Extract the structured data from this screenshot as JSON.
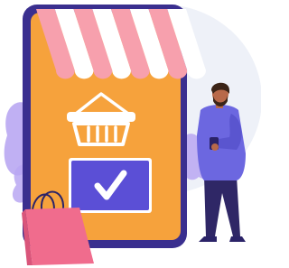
{
  "illustration": {
    "subject": "mobile-shopping",
    "colors": {
      "phone_frame": "#3a2f8f",
      "phone_screen": "#f6a23c",
      "awning_pink": "#f7a0ad",
      "awning_white": "#ffffff",
      "basket": "#ffffff",
      "checkout_card": "#5b4fd6",
      "check_mark": "#ffffff",
      "shopping_bag": "#f06c8d",
      "man_shirt": "#6c67e0",
      "man_pants": "#2f2766",
      "man_skin": "#b8694a",
      "man_hair": "#3b2417",
      "background_blob": "#eef1f8",
      "foliage": "#b9a7f2"
    },
    "icons": [
      "shopping-basket-icon",
      "checkmark-icon",
      "shopping-bag-icon",
      "smartphone-icon"
    ]
  }
}
